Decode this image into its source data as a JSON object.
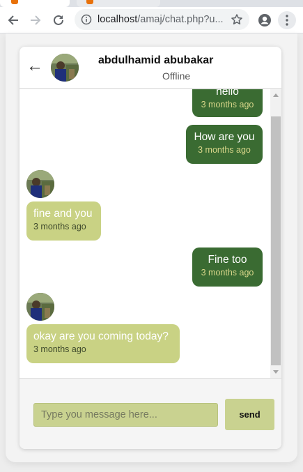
{
  "browser": {
    "url_host": "localhost",
    "url_path": "/amaj/chat.php?u...",
    "icons": [
      "back-icon",
      "forward-icon",
      "reload-icon",
      "info-icon",
      "star-icon",
      "profile-icon",
      "menu-icon"
    ]
  },
  "header": {
    "back_icon": "←",
    "name": "abdulhamid abubakar",
    "status": "Offline"
  },
  "messages": [
    {
      "direction": "out",
      "text": "hello",
      "time": "3 months ago"
    },
    {
      "direction": "out",
      "text": "How are you",
      "time": "3 months ago"
    },
    {
      "direction": "in",
      "text": "fine and you",
      "time": "3 months ago"
    },
    {
      "direction": "out",
      "text": "Fine too",
      "time": "3 months ago"
    },
    {
      "direction": "in",
      "text": "okay are you coming today?",
      "time": "3 months ago"
    }
  ],
  "composer": {
    "placeholder": "Type you message here...",
    "send_label": "send"
  },
  "colors": {
    "outgoing_bubble": "#3a6b32",
    "incoming_bubble": "#c9d284",
    "input_bg": "#c9d290"
  }
}
